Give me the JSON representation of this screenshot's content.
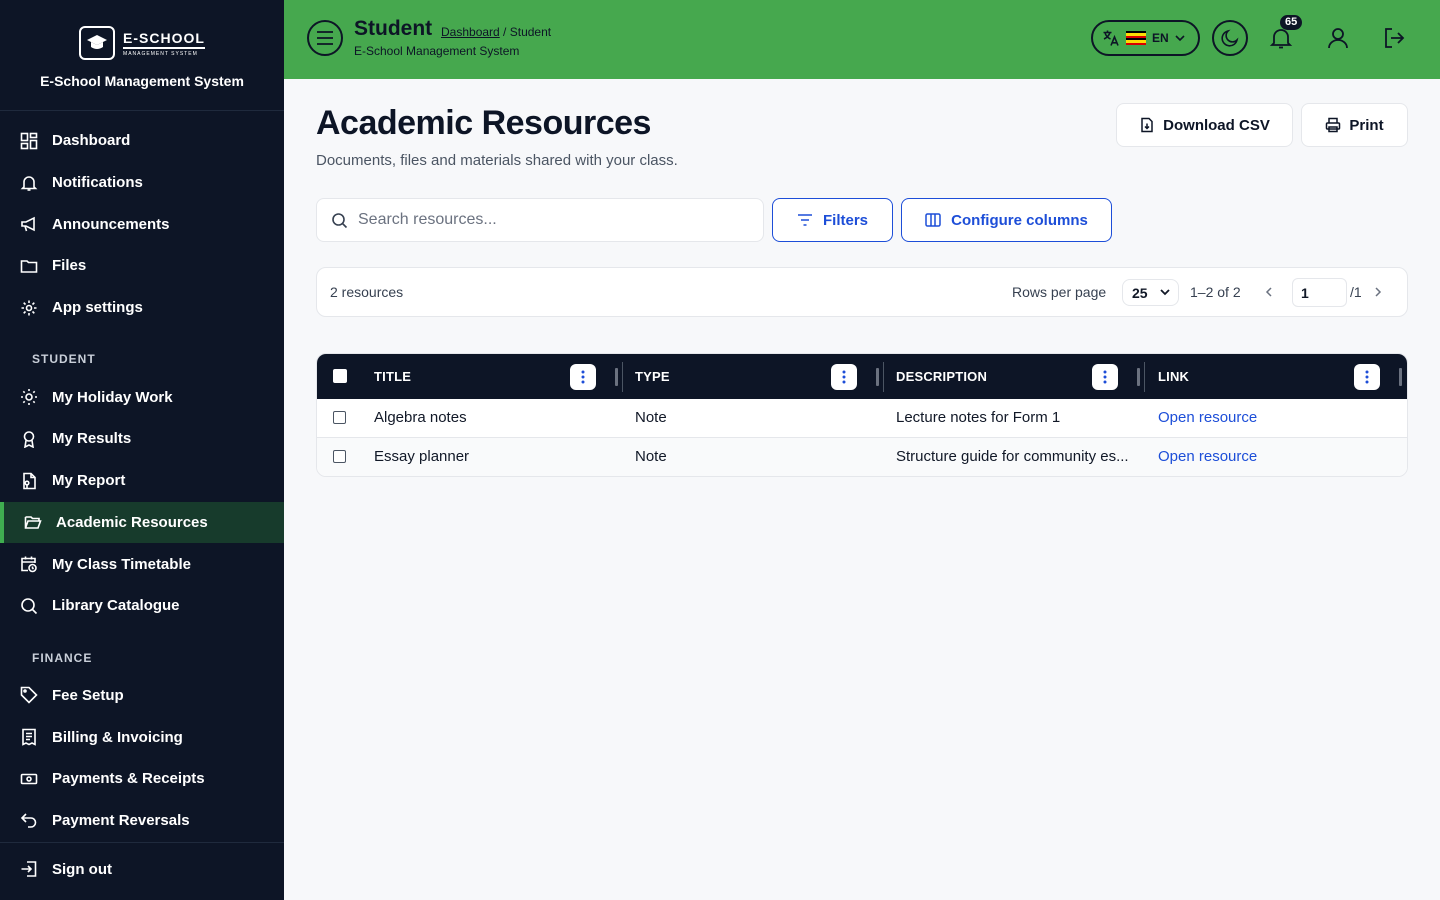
{
  "brand": {
    "logo_main": "E-SCHOOL",
    "logo_sub": "MANAGEMENT SYSTEM",
    "name": "E-School Management System"
  },
  "sidebar": {
    "items": [
      {
        "label": "Dashboard",
        "icon": "dashboard-icon"
      },
      {
        "label": "Notifications",
        "icon": "bell-icon"
      },
      {
        "label": "Announcements",
        "icon": "megaphone-icon"
      },
      {
        "label": "Files",
        "icon": "folder-icon"
      },
      {
        "label": "App settings",
        "icon": "gear-icon"
      }
    ],
    "section_student": "STUDENT",
    "student_items": [
      {
        "label": "My Holiday Work",
        "icon": "sun-icon"
      },
      {
        "label": "My Results",
        "icon": "award-icon"
      },
      {
        "label": "My Report",
        "icon": "report-icon"
      },
      {
        "label": "Academic Resources",
        "icon": "folder-open-icon",
        "active": true
      },
      {
        "label": "My Class Timetable",
        "icon": "calendar-clock-icon"
      },
      {
        "label": "Library Catalogue",
        "icon": "search-icon"
      }
    ],
    "section_finance": "FINANCE",
    "finance_items": [
      {
        "label": "Fee Setup",
        "icon": "tag-icon"
      },
      {
        "label": "Billing & Invoicing",
        "icon": "invoice-icon"
      },
      {
        "label": "Payments & Receipts",
        "icon": "banknote-icon"
      },
      {
        "label": "Payment Reversals",
        "icon": "undo-icon"
      }
    ],
    "sign_out": "Sign out"
  },
  "header": {
    "title": "Student",
    "breadcrumb_link": "Dashboard",
    "breadcrumb_sep": " / ",
    "breadcrumb_current": "Student",
    "subtitle": "E-School Management System",
    "language": "EN",
    "notification_count": "65"
  },
  "main": {
    "title": "Academic Resources",
    "subtitle": "Documents, files and materials shared with your class.",
    "download_csv": "Download CSV",
    "print": "Print",
    "search_placeholder": "Search resources...",
    "filters": "Filters",
    "configure_columns": "Configure columns"
  },
  "pager": {
    "count": "2 resources",
    "rows_per_page_label": "Rows per page",
    "rows_per_page": "25",
    "range": "1–2 of 2",
    "page": "1",
    "total": "/1"
  },
  "table": {
    "columns": [
      "TITLE",
      "TYPE",
      "DESCRIPTION",
      "LINK"
    ],
    "rows": [
      {
        "title": "Algebra notes",
        "type": "Note",
        "description": "Lecture notes for Form 1",
        "link": "Open resource"
      },
      {
        "title": "Essay planner",
        "type": "Note",
        "description": "Structure guide for community es...",
        "link": "Open resource"
      }
    ]
  },
  "colors": {
    "sidebar_bg": "#0d1526",
    "header_bg": "#46a84e",
    "accent_blue": "#1d4ed8",
    "active_bg": "#173b2c"
  }
}
